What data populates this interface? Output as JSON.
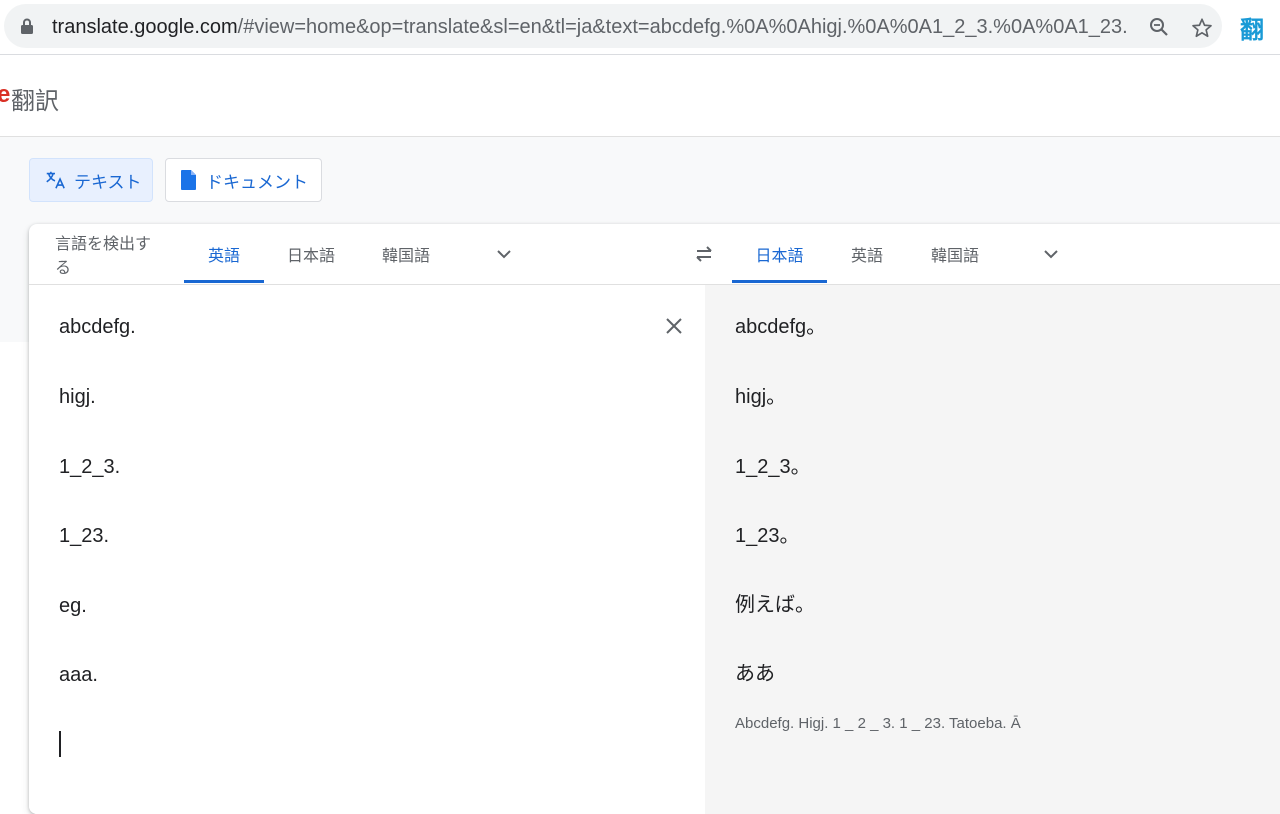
{
  "browser": {
    "url_domain": "translate.google.com",
    "url_rest": "/#view=home&op=translate&sl=en&tl=ja&text=abcdefg.%0A%0Ahigj.%0A%0A1_2_3.%0A%0A1_23.%0A%0...",
    "extension_glyph": "翻",
    "icons": [
      "lock-icon",
      "zoom-out-icon",
      "star-icon"
    ]
  },
  "header": {
    "logo_fragment": "e",
    "title": "翻訳"
  },
  "modes": {
    "text_label": "テキスト",
    "document_label": "ドキュメント"
  },
  "source_langs": {
    "detect": "言語を検出する",
    "english": "英語",
    "japanese": "日本語",
    "korean": "韓国語"
  },
  "target_langs": {
    "japanese": "日本語",
    "english": "英語",
    "korean": "韓国語"
  },
  "source_text": {
    "lines": [
      "abcdefg.",
      "higj.",
      "1_2_3.",
      "1_23.",
      "eg.",
      "aaa."
    ]
  },
  "target_text": {
    "lines": [
      "abcdefg。",
      "higj。",
      "1_2_3。",
      "1_23。",
      "例えば。",
      "ああ"
    ],
    "romanization": "Abcdefg. Higj. 1 _ 2 _ 3. 1 _ 23. Tatoeba. Ā"
  },
  "colors": {
    "accent": "#1967d2",
    "target_bg": "#f5f5f5",
    "logo_red": "#d93025"
  }
}
